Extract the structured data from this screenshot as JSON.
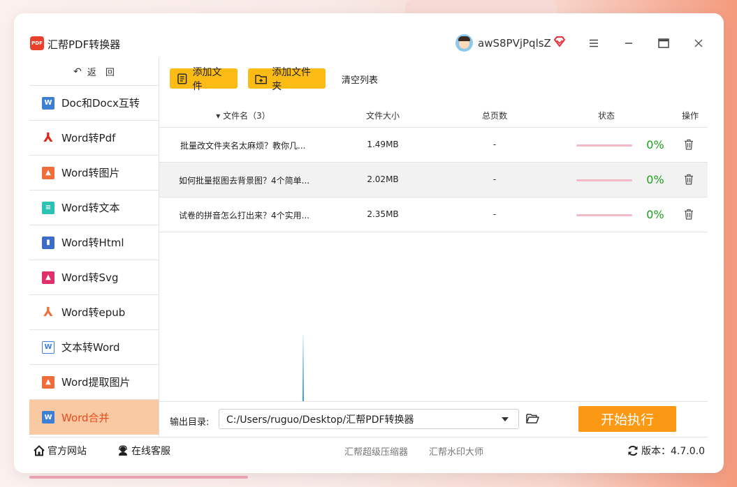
{
  "app": {
    "title": "汇帮PDF转换器",
    "logo_text": "PDF",
    "username": "awS8PVjPqlsZ"
  },
  "colors": {
    "accent": "#fcbb15",
    "start": "#fb9814",
    "active_bg": "#f9c9a4",
    "active_text": "#e74c1d",
    "progress_text": "#1aa01a"
  },
  "sidebar": {
    "back_label": "返　回",
    "items": [
      {
        "label": "Doc和Docx互转",
        "icon": "word-icon",
        "glyph": "W"
      },
      {
        "label": "Word转Pdf",
        "icon": "pdf-icon",
        "glyph": "⅄"
      },
      {
        "label": "Word转图片",
        "icon": "image-icon",
        "glyph": "▲"
      },
      {
        "label": "Word转文本",
        "icon": "text-file-icon",
        "glyph": "≡"
      },
      {
        "label": "Word转Html",
        "icon": "html-icon",
        "glyph": "▮"
      },
      {
        "label": "Word转Svg",
        "icon": "svg-icon",
        "glyph": "▲"
      },
      {
        "label": "Word转epub",
        "icon": "epub-icon",
        "glyph": "⅄"
      },
      {
        "label": "文本转Word",
        "icon": "text-to-word-icon",
        "glyph": "W"
      },
      {
        "label": "Word提取图片",
        "icon": "extract-image-icon",
        "glyph": "▲"
      },
      {
        "label": "Word合并",
        "icon": "word-merge-icon",
        "glyph": "W"
      }
    ]
  },
  "toolbar": {
    "add_file": "添加文件",
    "add_folder": "添加文件夹",
    "clear_list": "清空列表"
  },
  "table": {
    "headers": {
      "name": "▾ 文件名（3）",
      "size": "文件大小",
      "pages": "总页数",
      "status": "状态",
      "op": "操作"
    },
    "rows": [
      {
        "name": "批量改文件夹名太麻烦？教你几...",
        "size": "1.49MB",
        "pages": "-",
        "progress": "0%"
      },
      {
        "name": "如何批量抠图去背景图？4个简单...",
        "size": "2.02MB",
        "pages": "-",
        "progress": "0%"
      },
      {
        "name": "试卷的拼音怎么打出来？4个实用...",
        "size": "2.35MB",
        "pages": "-",
        "progress": "0%"
      }
    ]
  },
  "output": {
    "label": "输出目录:",
    "path": "C:/Users/ruguo/Desktop/汇帮PDF转换器",
    "start": "开始执行"
  },
  "footer": {
    "website": "官方网站",
    "support": "在线客服",
    "link1": "汇帮超级压缩器",
    "link2": "汇帮水印大师",
    "version": "版本：4.7.0.0"
  }
}
